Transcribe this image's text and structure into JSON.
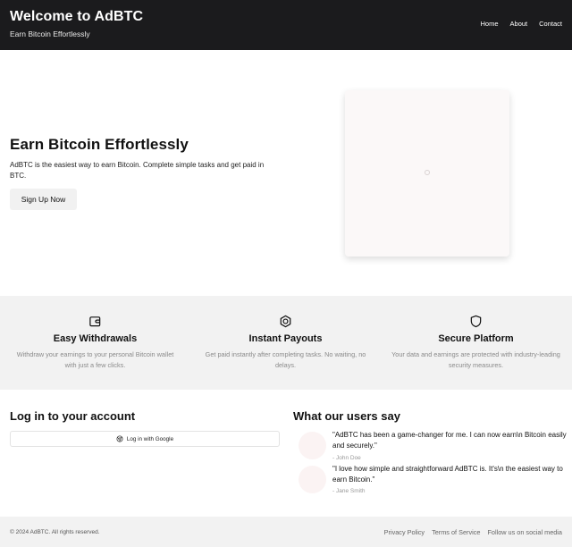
{
  "header": {
    "title": "Welcome to AdBTC",
    "tagline": "Earn Bitcoin Effortlessly",
    "nav": [
      "Home",
      "About",
      "Contact"
    ]
  },
  "hero": {
    "title": "Earn Bitcoin Effortlessly",
    "text": "AdBTC is the easiest way to earn Bitcoin. Complete simple tasks and get paid in BTC.",
    "signup_label": "Sign Up Now"
  },
  "features": [
    {
      "icon": "wallet-icon",
      "title": "Easy Withdrawals",
      "description": "Withdraw your earnings to your personal Bitcoin wallet with just a few clicks."
    },
    {
      "icon": "instant-payout-icon",
      "title": "Instant Payouts",
      "description": "Get paid instantly after completing tasks. No waiting, no delays."
    },
    {
      "icon": "shield-icon",
      "title": "Secure Platform",
      "description": "Your data and earnings are protected with industry-leading security measures."
    }
  ],
  "login": {
    "title": "Log in to your account",
    "google_label": "Log in with Google"
  },
  "testimonials": {
    "title": "What our users say",
    "items": [
      {
        "quote": "\"AdBTC has been a game-changer for me. I can now earn\\n Bitcoin easily and securely.\"",
        "author": "- John Doe"
      },
      {
        "quote": "\"I love how simple and straightforward AdBTC is. It's\\n the easiest way to earn Bitcoin.\"",
        "author": "- Jane Smith"
      }
    ]
  },
  "footer": {
    "copyright": "© 2024 AdBTC. All rights reserved.",
    "links": [
      "Privacy Policy",
      "Terms of Service",
      "Follow us on social media"
    ]
  }
}
